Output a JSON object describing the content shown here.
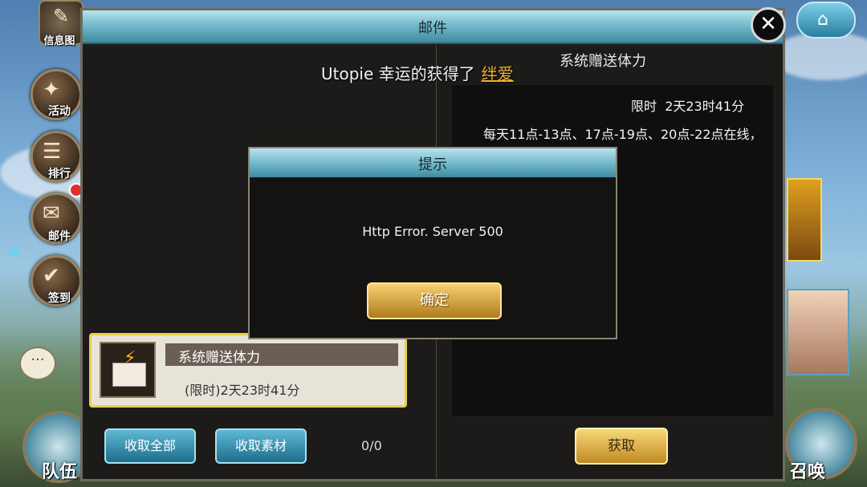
{
  "colors": {
    "accent_blue": "#6fb6c8",
    "accent_gold": "#f0b030",
    "highlight_border": "#e6d24a"
  },
  "left_menu": [
    {
      "label": "信息图",
      "icon": "info-map-icon"
    },
    {
      "label": "活动",
      "icon": "activity-bag-icon"
    },
    {
      "label": "排行",
      "icon": "ranking-icon"
    },
    {
      "label": "邮件",
      "icon": "mail-icon"
    },
    {
      "label": "签到",
      "icon": "signin-icon"
    }
  ],
  "header": {
    "title": "邮件",
    "close_icon": "close-icon",
    "home_icon": "home-icon"
  },
  "announcement": {
    "prefix": "Utopie 幸运的获得了",
    "item": "绊爱"
  },
  "detail": {
    "title": "系统赠送体力",
    "limit_label": "限时",
    "limit_time": "2天23时41分",
    "text": "每天11点-13点、17点-19点、20点-22点在线，所获得的体力奖励"
  },
  "mail_list": [
    {
      "name": "系统赠送体力",
      "sub": "(限时)2天23时41分",
      "icon": "energy-mail-icon"
    }
  ],
  "actions": {
    "collect_all": "收取全部",
    "collect_materials": "收取素材",
    "count": "0/0",
    "claim": "获取"
  },
  "dialog": {
    "title": "提示",
    "message": "Http Error. Server 500",
    "ok": "确定"
  },
  "bottom_nav": {
    "left": "队伍",
    "right": "召唤"
  }
}
